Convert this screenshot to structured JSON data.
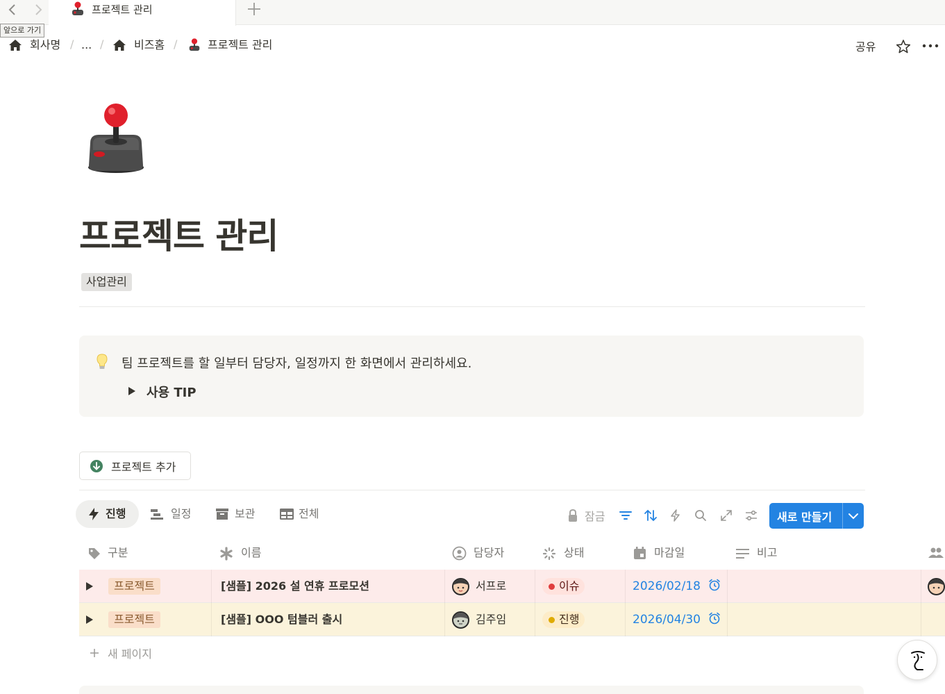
{
  "tabbar": {
    "tab_title": "프로젝트 관리",
    "tooltip": "앞으로 가기"
  },
  "breadcrumb": {
    "items": [
      "회사명",
      "...",
      "비즈홈",
      "프로젝트 관리"
    ]
  },
  "topbar": {
    "share_label": "공유"
  },
  "page": {
    "title": "프로젝트 관리",
    "tag": "사업관리"
  },
  "callout": {
    "text": "팀 프로젝트를 할 일부터 담당자, 일정까지 한 화면에서 관리하세요.",
    "toggle_label": "사용 TIP"
  },
  "add_button": {
    "label": "프로젝트 추가"
  },
  "views": {
    "tabs": [
      {
        "label": "진행",
        "active": true
      },
      {
        "label": "일정",
        "active": false
      },
      {
        "label": "보관",
        "active": false
      },
      {
        "label": "전체",
        "active": false
      }
    ],
    "lock_label": "잠금",
    "new_button": "새로 만들기"
  },
  "table": {
    "columns": [
      "구분",
      "이름",
      "담당자",
      "상태",
      "마감일",
      "비고"
    ],
    "rows": [
      {
        "category": "프로젝트",
        "name": "[샘플] 2026 설 연휴 프로모션",
        "assignee": "서프로",
        "status": "이슈",
        "due": "2026/02/18",
        "note": ""
      },
      {
        "category": "프로젝트",
        "name": "[샘플] OOO 텀블러 출시",
        "assignee": "김주임",
        "status": "진행",
        "due": "2026/04/30",
        "note": ""
      }
    ],
    "new_page_label": "새 페이지"
  },
  "colors": {
    "accent": "#2383e2",
    "row_issue_bg": "#fdebea",
    "row_progress_bg": "#fbf3db",
    "status_issue_bg": "#ffe2dd",
    "status_issue_dot": "#e03e3e",
    "status_progress_bg": "#fdecc8",
    "status_progress_dot": "#dfab01"
  }
}
